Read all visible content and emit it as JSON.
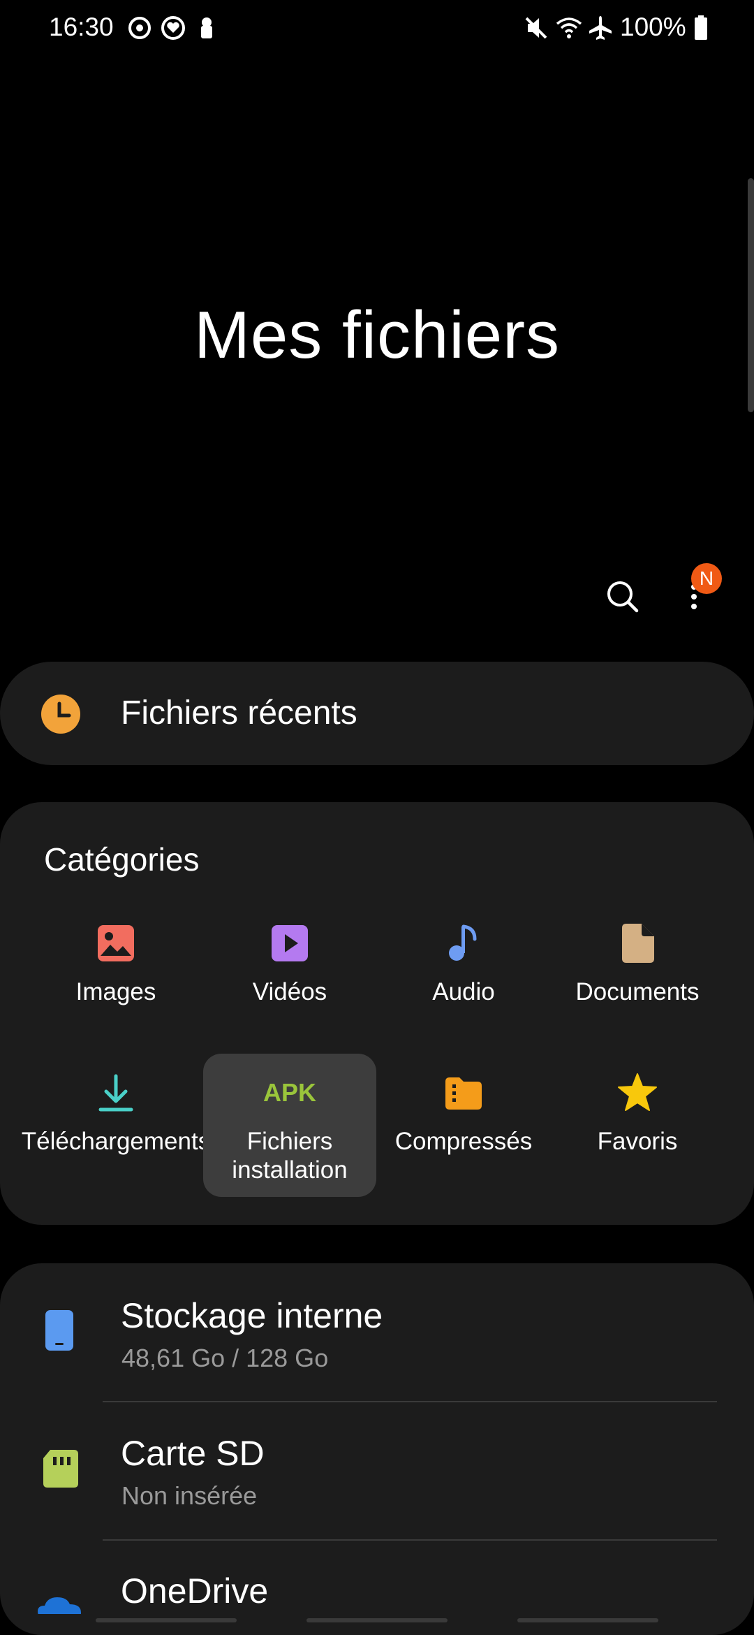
{
  "status": {
    "time": "16:30",
    "battery": "100%",
    "icons": [
      "sync-icon",
      "heart-icon",
      "keyhole-icon",
      "mute-icon",
      "wifi-icon",
      "airplane-icon",
      "battery-icon"
    ]
  },
  "title": "Mes fichiers",
  "actions": {
    "search_icon": "search-icon",
    "more_icon": "more-vert-icon",
    "badge": "N"
  },
  "recent": {
    "label": "Fichiers récents",
    "icon": "clock-icon"
  },
  "categories": {
    "title": "Catégories",
    "items": [
      {
        "label": "Images",
        "icon": "image-icon",
        "color": "#f26d5f"
      },
      {
        "label": "Vidéos",
        "icon": "video-icon",
        "color": "#b47af0"
      },
      {
        "label": "Audio",
        "icon": "music-note-icon",
        "color": "#6e9cf2"
      },
      {
        "label": "Documents",
        "icon": "document-icon",
        "color": "#d4b084"
      },
      {
        "label": "Télécharge­ments",
        "icon": "download-icon",
        "color": "#4ad0c8"
      },
      {
        "label": "Fichiers installation",
        "icon": "apk-icon",
        "color": "#9ac53b",
        "selected": true
      },
      {
        "label": "Compressés",
        "icon": "zip-folder-icon",
        "color": "#f49c1a"
      },
      {
        "label": "Favoris",
        "icon": "star-icon",
        "color": "#f8c80c"
      }
    ],
    "apk_text": "APK"
  },
  "storage": [
    {
      "title": "Stockage interne",
      "subtitle": "48,61 Go / 128 Go",
      "icon": "phone-icon",
      "color": "#5b9af0"
    },
    {
      "title": "Carte SD",
      "subtitle": "Non insérée",
      "icon": "sd-card-icon",
      "color": "#b5d05a"
    },
    {
      "title": "OneDrive",
      "subtitle": "",
      "icon": "cloud-icon",
      "color": "#1e72d6"
    }
  ]
}
